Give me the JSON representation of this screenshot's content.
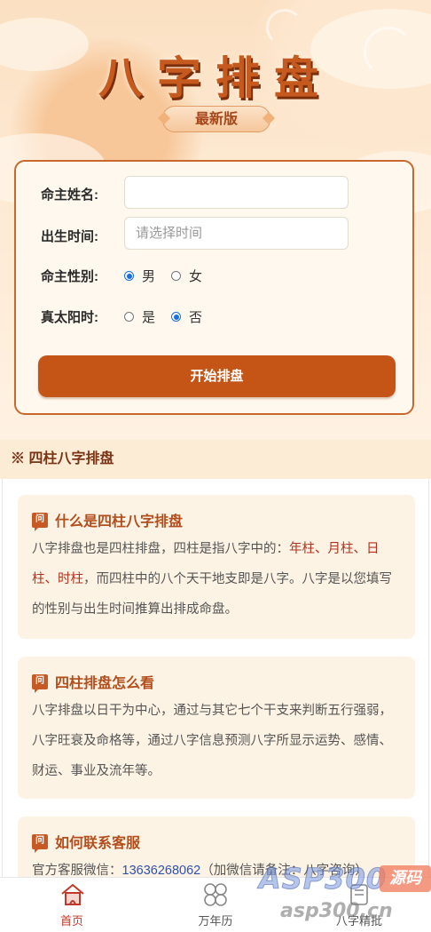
{
  "header": {
    "title": "八字排盘",
    "badge": "最新版"
  },
  "form": {
    "name_label": "命主姓名:",
    "name_value": "",
    "time_label": "出生时间:",
    "time_placeholder": "请选择时间",
    "gender_label": "命主性别:",
    "gender_options": [
      "男",
      "女"
    ],
    "gender_selected": "男",
    "solar_label": "真太阳时:",
    "solar_options": [
      "是",
      "否"
    ],
    "solar_selected": "否",
    "submit_label": "开始排盘"
  },
  "section": {
    "title": "※ 四柱八字排盘"
  },
  "cards": [
    {
      "title": "什么是四柱八字排盘",
      "icon": "question-icon",
      "text_before": "八字排盘也是四柱排盘，四柱是指八字中的：",
      "highlights": [
        "年柱",
        "月柱",
        "日柱",
        "时柱"
      ],
      "sep": "、",
      "text_after": "，而四柱中的八个天干地支即是八字。八字是以您填写的性别与出生时间推算出排成命盘。"
    },
    {
      "title": "四柱排盘怎么看",
      "icon": "question-icon",
      "text": "八字排盘以日干为中心，通过与其它七个干支来判断五行强弱，八字旺衰及命格等，通过八字信息预测八字所显示运势、感情、财运、事业及流年等。"
    },
    {
      "title": "如何联系客服",
      "icon": "question-icon",
      "text_before": "官方客服微信：",
      "phone": "13636268062",
      "text_after": "（加微信请备注：八字咨询）"
    }
  ],
  "tabbar": [
    {
      "label": "首页",
      "icon": "home-icon",
      "active": true
    },
    {
      "label": "万年历",
      "icon": "calendar-icon",
      "active": false
    },
    {
      "label": "八字精批",
      "icon": "book-icon",
      "active": false
    }
  ],
  "watermark": {
    "brand": "ASP300",
    "tag": "源码",
    "site": "asp300.cn"
  },
  "colors": {
    "accent": "#c45517",
    "title": "#c65a1e",
    "card_bg": "#fdf3e4",
    "highlight": "#b4311f"
  }
}
